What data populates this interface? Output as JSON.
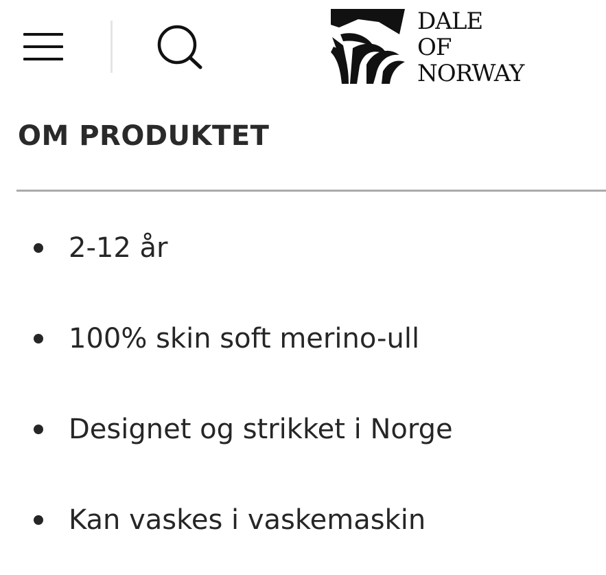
{
  "header": {
    "menu_icon": "hamburger-menu-icon",
    "search_icon": "search-icon",
    "logo": {
      "line1": "DALE",
      "line2": "OF",
      "line3": "NORWAY"
    }
  },
  "section": {
    "title": "OM PRODUKTET",
    "features": [
      "2-12 år",
      "100% skin soft merino-ull",
      "Designet og strikket i Norge",
      "Kan vaskes i vaskemaskin"
    ]
  },
  "colors": {
    "text": "#262626",
    "divider": "#aaaaaa",
    "background": "#ffffff"
  }
}
